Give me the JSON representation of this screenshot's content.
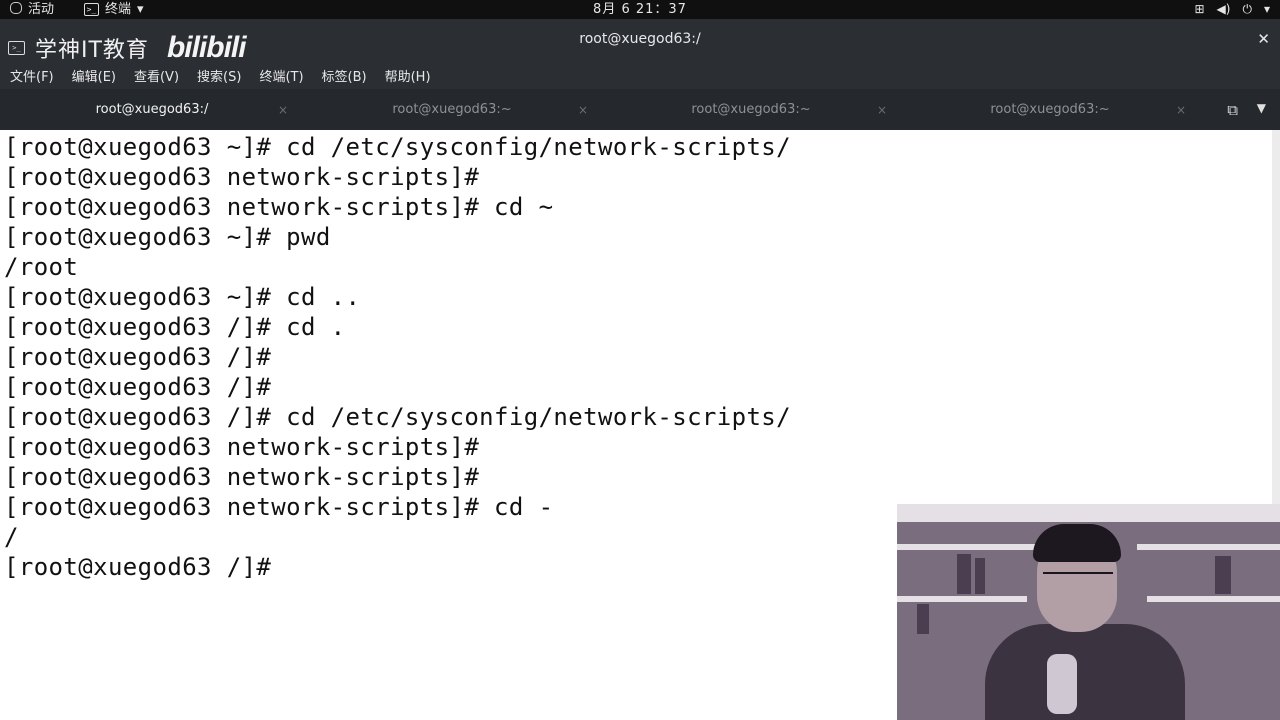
{
  "topbar": {
    "activities_icon": "gnome-activities-icon",
    "activities": "活动",
    "app_icon": "terminal-icon",
    "app_name": "终端",
    "app_menu_arrow": "▾",
    "clock": "8月 6  21：37",
    "sys_icons": [
      "network-icon",
      "volume-icon",
      "power-icon"
    ],
    "sys_arrow": "▾"
  },
  "titlebar": {
    "logo_text": "学神IT教育",
    "bili_logo": "bilibili",
    "title": "root@xuegod63:/",
    "close": "✕"
  },
  "menubar": {
    "items": [
      "文件(F)",
      "编辑(E)",
      "查看(V)",
      "搜索(S)",
      "终端(T)",
      "标签(B)",
      "帮助(H)"
    ]
  },
  "tabs": [
    {
      "label": "root@xuegod63:/",
      "active": true,
      "close": "×"
    },
    {
      "label": "root@xuegod63:~",
      "active": false,
      "close": "×"
    },
    {
      "label": "root@xuegod63:~",
      "active": false,
      "close": "×"
    },
    {
      "label": "root@xuegod63:~",
      "active": false,
      "close": "×"
    }
  ],
  "tab_controls": {
    "new_tab": "⧉",
    "menu": "▼"
  },
  "terminal": {
    "lines": [
      "[root@xuegod63 ~]# cd /etc/sysconfig/network-scripts/",
      "[root@xuegod63 network-scripts]#",
      "[root@xuegod63 network-scripts]# cd ~",
      "[root@xuegod63 ~]# pwd",
      "/root",
      "[root@xuegod63 ~]# cd ..",
      "[root@xuegod63 /]# cd .",
      "[root@xuegod63 /]#",
      "[root@xuegod63 /]#",
      "[root@xuegod63 /]# cd /etc/sysconfig/network-scripts/",
      "[root@xuegod63 network-scripts]#",
      "[root@xuegod63 network-scripts]#",
      "[root@xuegod63 network-scripts]# cd -",
      "/",
      "[root@xuegod63 /]#"
    ]
  },
  "colors": {
    "topbar_bg": "#101010",
    "titlebar_bg": "#2b2e33",
    "tabbar_bg": "#25282c",
    "terminal_bg": "#ffffff",
    "terminal_fg": "#111111"
  }
}
